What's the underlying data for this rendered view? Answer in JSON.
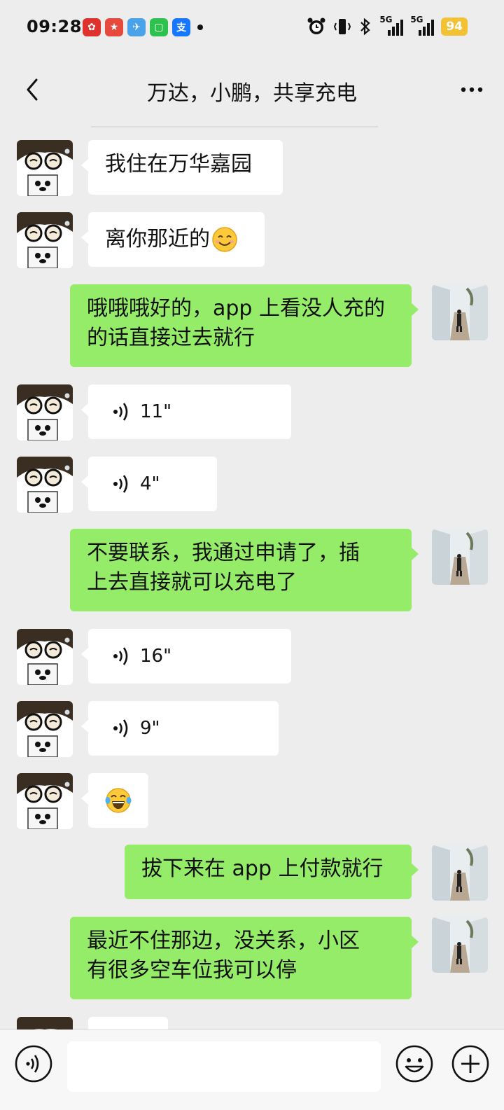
{
  "status_bar": {
    "time": "09:28",
    "network_label_1": "5G",
    "network_label_2": "5G",
    "battery": "94"
  },
  "header": {
    "title": "万达，小鹏，共享充电",
    "back_icon": "chevron-left-icon",
    "more_icon": "more-dots-icon"
  },
  "messages": [
    {
      "side": "in",
      "type": "text",
      "text": "我住在万华嘉园"
    },
    {
      "side": "in",
      "type": "text",
      "text": "离你那近的",
      "emoji": "smiling-face"
    },
    {
      "side": "out",
      "type": "text",
      "line1": "哦哦哦好的，app 上看没人充的",
      "line2": "的话直接过去就行"
    },
    {
      "side": "in",
      "type": "voice",
      "duration": "11\""
    },
    {
      "side": "in",
      "type": "voice",
      "duration": "4\""
    },
    {
      "side": "out",
      "type": "text",
      "line1": "不要联系，我通过申请了，插",
      "line2": "上去直接就可以充电了"
    },
    {
      "side": "in",
      "type": "voice",
      "duration": "16\""
    },
    {
      "side": "in",
      "type": "voice",
      "duration": "9\""
    },
    {
      "side": "in",
      "type": "emoji",
      "emoji": "tears-of-joy"
    },
    {
      "side": "out",
      "type": "text",
      "text": "拔下来在 app 上付款就行"
    },
    {
      "side": "out",
      "type": "text",
      "line1": "最近不住那边，没关系，小区",
      "line2": "有很多空车位我可以停"
    }
  ],
  "input": {
    "value": "",
    "placeholder": ""
  },
  "colors": {
    "bubble_out": "#95ec69",
    "bubble_in": "#ffffff",
    "background": "#ededed",
    "battery": "#f2c233"
  }
}
